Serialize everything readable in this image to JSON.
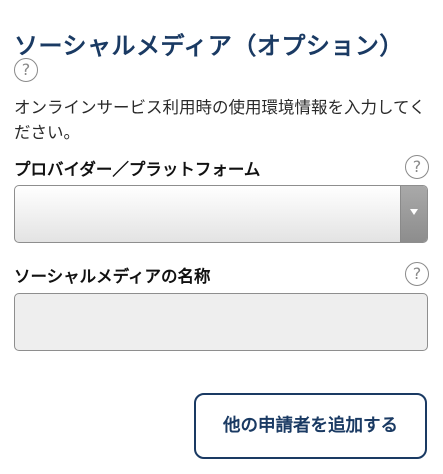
{
  "section": {
    "title": "ソーシャルメディア（オプション）",
    "help_glyph": "?",
    "description": "オンラインサービス利用時の使用環境情報を入力してください。"
  },
  "provider_field": {
    "label": "プロバイダー／プラットフォーム",
    "help_glyph": "?",
    "selected_value": ""
  },
  "name_field": {
    "label": "ソーシャルメディアの名称",
    "help_glyph": "?",
    "value": "",
    "placeholder": ""
  },
  "actions": {
    "add_applicant_label": "他の申請者を追加する"
  },
  "colors": {
    "accent": "#1a3a63",
    "icon_gray": "#8a8a8a",
    "input_bg": "#eeeeee"
  },
  "icons": [
    "question-circle-icon",
    "chevron-down-icon"
  ]
}
